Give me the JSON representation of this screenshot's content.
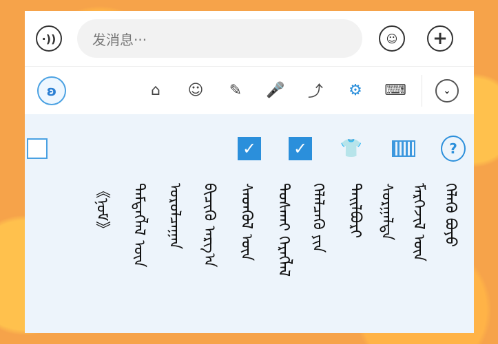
{
  "input": {
    "placeholder": "发消息···",
    "voice_icon": "voice-icon",
    "emoji_icon": "smiley-icon",
    "plus_icon": "plus-icon"
  },
  "toolbar": {
    "logo_icon": "app-logo-icon",
    "icons": [
      "home-icon",
      "smiley-icon",
      "pencil-icon",
      "microphone-icon",
      "share-icon",
      "gear-icon",
      "keyboard-icon"
    ],
    "collapse_icon": "chevron-down-icon"
  },
  "panel": {
    "controls": [
      "checkbox-empty",
      "checkbox-checked",
      "checkbox-checked",
      "tshirt-icon",
      "keyboard-icon",
      "help-icon"
    ],
    "mongolian_lines": [
      "ᠬᠡᠯᠡᠬᠦ ᠪᠤᠶᠤ",
      "ᠮᠡᠷᠭᠡᠵᠢᠯ ᠦᠨ",
      "ᠰᠤᠷᠭᠠᠯᠲᠠ",
      "ᠲᠠᠢᠯᠪᠤᠷᠢ",
      "ᠬᠡᠯᠡᠯᠴᠡᠬᠦ ᠶᠢᠨ",
      "ᠲᠤᠰᠬᠠᠢ ᠬᠡᠷᠡᠭᠯᠡᠯ",
      "ᠰᠡᠳᠭᠦᠯ ᠦᠨ",
      "ᠪᠢᠴᠢᠬᠦ ᠠᠷᠭ᠎ᠠ",
      "ᠤᠷᠤᠯᠴᠠᠭᠠᠨ",
      "ᠲᠡᠮᠳᠡᠭᠯᠡᠯ ᠦᠨ",
      "《ᠨᠣᠮ》"
    ]
  },
  "colors": {
    "accent": "#2b8fdb",
    "panel_bg": "#edf4fb",
    "background_orange": "#f6a34a"
  }
}
